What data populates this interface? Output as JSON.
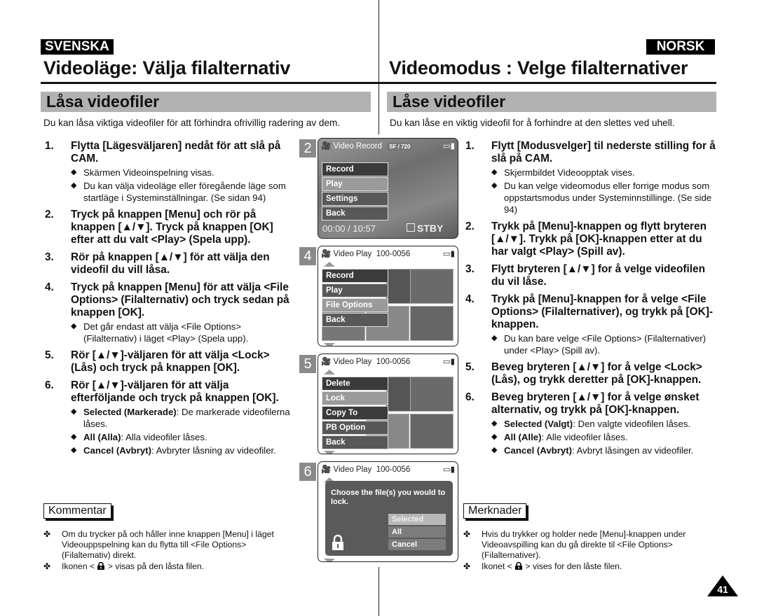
{
  "left": {
    "language": "SVENSKA",
    "title": "Videoläge: Välja filalternativ",
    "section": "Låsa videofiler",
    "intro": "Du kan låsa viktiga videofiler för att förhindra ofrivillig radering av dem.",
    "steps": [
      {
        "num": "1.",
        "text": "Flytta [Lägesväljaren] nedåt för att slå på CAM.",
        "bullets": [
          "Skärmen Videoinspelning visas.",
          "Du kan välja videoläge eller föregående läge som startläge i Systeminställningar. (Se sidan 94)"
        ]
      },
      {
        "num": "2.",
        "text": "Tryck på knappen [Menu] och rör på knappen [▲/▼]. Tryck på knappen [OK] efter att du valt <Play> (Spela upp).",
        "bullets": []
      },
      {
        "num": "3.",
        "text": "Rör på knappen [▲/▼] för att välja den videofil du vill låsa.",
        "bullets": []
      },
      {
        "num": "4.",
        "text": "Tryck på knappen [Menu] för att välja <File Options> (Filalternativ) och tryck sedan på knappen [OK].",
        "bullets": [
          "Det går endast att välja <File Options> (Filalternativ) i läget <Play> (Spela upp)."
        ]
      },
      {
        "num": "5.",
        "text": "Rör [▲/▼]-väljaren för att välja <Lock> (Lås) och tryck på knappen [OK].",
        "bullets": []
      },
      {
        "num": "6.",
        "text": "Rör [▲/▼]-väljaren för att välja efterföljande och tryck på knappen [OK].",
        "bullets": []
      }
    ],
    "step6_options": [
      {
        "term": "Selected (Markerade)",
        "desc": ": De markerade videofilerna låses."
      },
      {
        "term": "All (Alla)",
        "desc": ": Alla videofiler låses."
      },
      {
        "term": "Cancel (Avbryt)",
        "desc": ": Avbryter låsning av videofiler."
      }
    ],
    "note_heading": "Kommentar",
    "notes": [
      "Om du trycker på och håller inne knappen [Menu] i läget Videouppspelning kan du flytta till <File Options> (Filaltemativ) direkt.",
      {
        "before": "Ikonen < ",
        "after": " > visas på den låsta filen."
      }
    ]
  },
  "right": {
    "language": "NORSK",
    "title": "Videomodus : Velge filalternativer",
    "section": "Låse videofiler",
    "intro": "Du kan låse en viktig videofil for å forhindre at den slettes ved uhell.",
    "steps": [
      {
        "num": "1.",
        "text": "Flytt [Modusvelger] til nederste stilling for å slå på CAM.",
        "bullets": [
          "Skjermbildet Videoopptak vises.",
          "Du kan velge videomodus eller forrige modus som oppstartsmodus under Systeminnstillinge. (Se side 94)"
        ]
      },
      {
        "num": "2.",
        "text": "Trykk på [Menu]-knappen og flytt bryteren [▲/▼]. Trykk på [OK]-knappen etter at du har valgt <Play> (Spill av).",
        "bullets": []
      },
      {
        "num": "3.",
        "text": "Flytt bryteren [▲/▼] for å velge videofilen du vil låse.",
        "bullets": []
      },
      {
        "num": "4.",
        "text": "Trykk på [Menu]-knappen for å velge <File Options> (Filalternativer), og trykk på [OK]-knappen.",
        "bullets": [
          "Du kan bare velge <File Options> (Filalternativer) under <Play> (Spill av)."
        ]
      },
      {
        "num": "5.",
        "text": "Beveg bryteren [▲/▼] for å velge <Lock> (Lås), og trykk deretter på [OK]-knappen.",
        "bullets": []
      },
      {
        "num": "6.",
        "text": "Beveg bryteren [▲/▼] for å velge ønsket alternativ, og trykk på [OK]-knappen.",
        "bullets": []
      }
    ],
    "step6_options": [
      {
        "term": "Selected (Valgt)",
        "desc": ": Den valgte videofilen låses."
      },
      {
        "term": "All (Alle)",
        "desc": ": Alle videofiler låses."
      },
      {
        "term": "Cancel (Avbryt)",
        "desc": ": Avbryt låsingen av videofiler."
      }
    ],
    "note_heading": "Merknader",
    "notes": [
      "Hvis du trykker og holder nede [Menu]-knappen under Videoavspilling kan du gå direkte til <File Options> (Filalternativer).",
      {
        "before": "Ikonet  < ",
        "after": " > vises for den låste filen."
      }
    ]
  },
  "screens": [
    {
      "badge": "2",
      "header": "Video Record",
      "quality": "SF / 720",
      "menu": [
        "Record",
        "Play",
        "Settings",
        "Back"
      ],
      "menu_selected": 1,
      "time": "00:00 / 10:57",
      "status": "STBY"
    },
    {
      "badge": "4",
      "header": "Video Play",
      "file": "100-0056",
      "menu": [
        "Record",
        "Play",
        "File Options",
        "Back"
      ],
      "menu_selected": 2
    },
    {
      "badge": "5",
      "header": "Video Play",
      "file": "100-0056",
      "menu": [
        "Delete",
        "Lock",
        "Copy To",
        "PB Option",
        "Back"
      ],
      "menu_selected": 1
    },
    {
      "badge": "6",
      "header": "Video Play",
      "file": "100-0056",
      "dialog": "Choose the file(s) you would to lock.",
      "options": [
        "Selected",
        "All",
        "Cancel"
      ],
      "options_selected": 0
    }
  ],
  "page_number": "41"
}
